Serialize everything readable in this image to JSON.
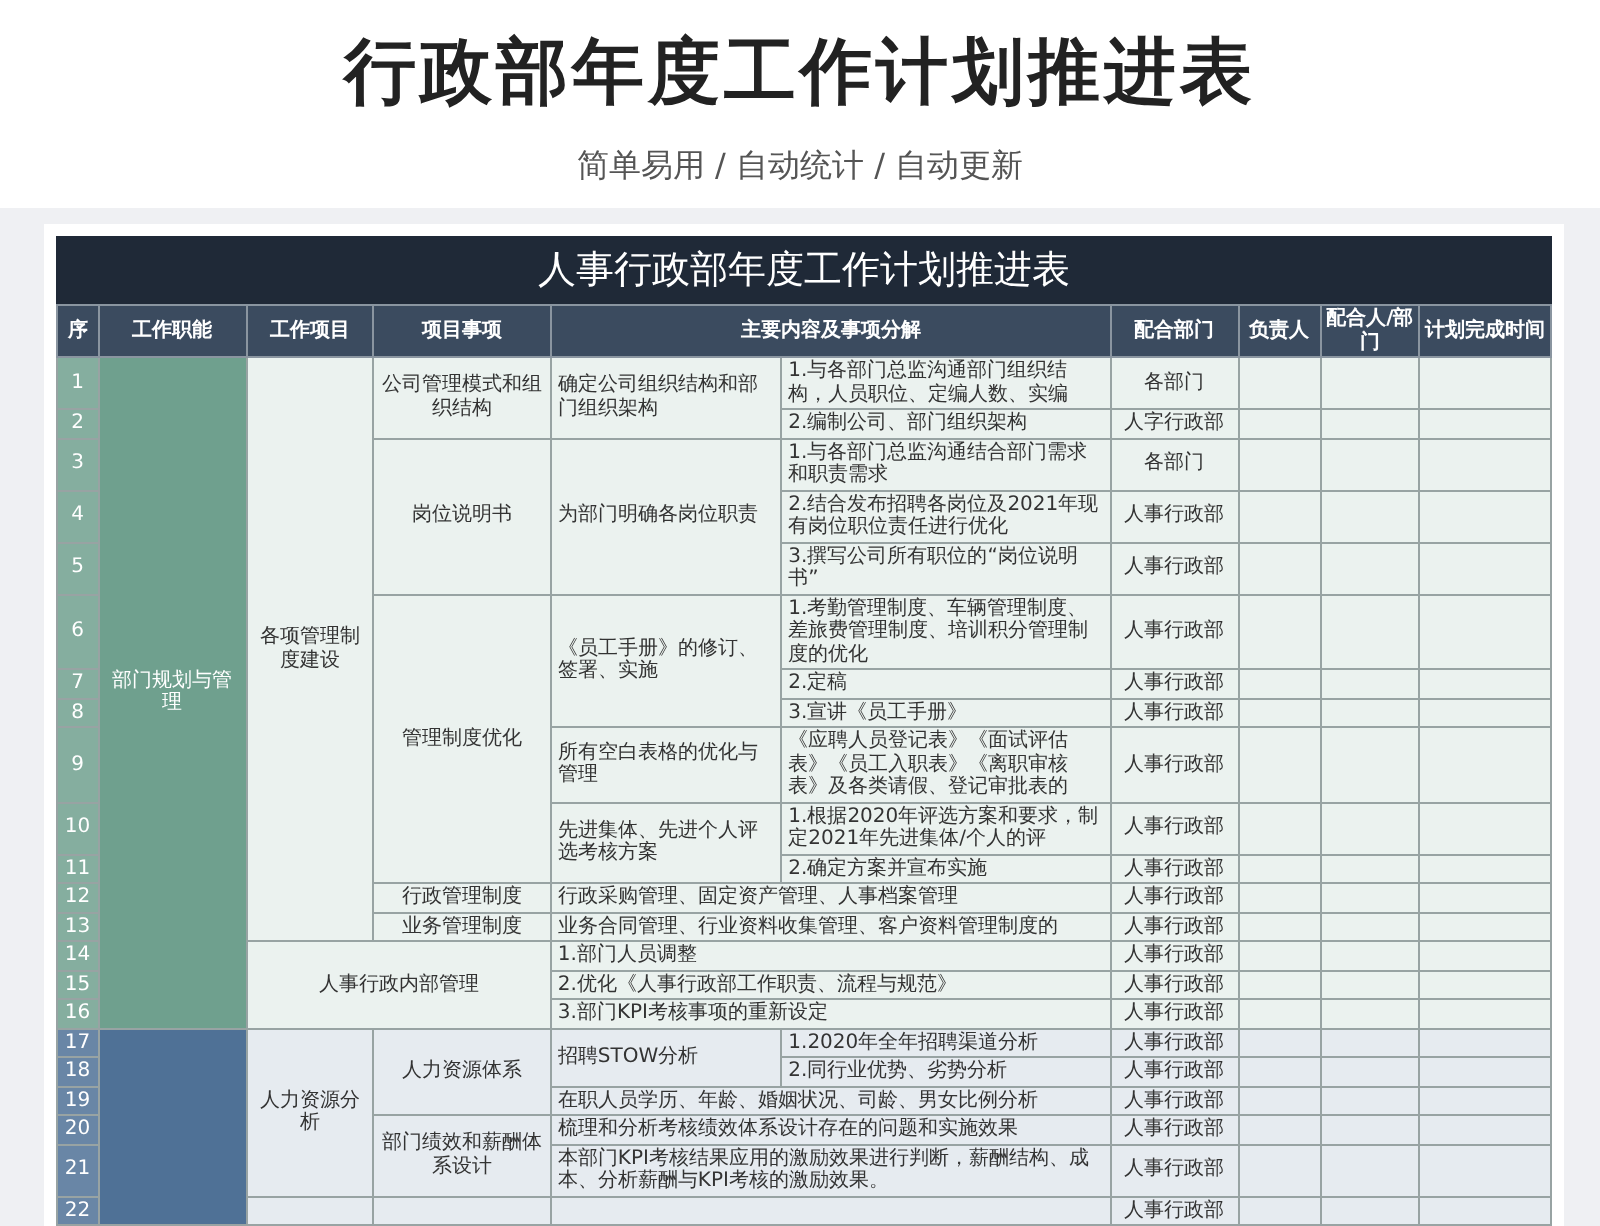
{
  "page": {
    "title": "行政部年度工作计划推进表",
    "subtitle": "简单易用 / 自动统计 / 自动更新"
  },
  "sheet": {
    "title": "人事行政部年度工作计划推进表",
    "columns": [
      "序",
      "工作职能",
      "工作项目",
      "项目事项",
      "主要内容及事项分解",
      "配合部门",
      "负责人",
      "配合人/部门",
      "计划完成时间"
    ],
    "functions": [
      {
        "text": "部门规划与管理",
        "color": "#6fa08e",
        "children": [
          {
            "text": "各项管理制度建设",
            "kind": "normal",
            "children": [
              {
                "text": "公司管理模式和组织结构",
                "children": [
                  {
                    "text": "确定公司组织结构和部门组织架构",
                    "children": [
                      {
                        "text": "1.与各部门总监沟通部门组织结构，人员职位、定编人数、实编",
                        "seq": "1",
                        "dept": "各部门"
                      },
                      {
                        "text": "2.编制公司、部门组织架构",
                        "seq": "2",
                        "dept": "人字行政部"
                      }
                    ]
                  }
                ]
              },
              {
                "text": "岗位说明书",
                "children": [
                  {
                    "text": "为部门明确各岗位职责",
                    "children": [
                      {
                        "text": "1.与各部门总监沟通结合部门需求和职责需求",
                        "seq": "3",
                        "dept": "各部门"
                      },
                      {
                        "text": "2.结合发布招聘各岗位及2021年现有岗位职位责任进行优化",
                        "seq": "4",
                        "dept": "人事行政部"
                      },
                      {
                        "text": "3.撰写公司所有职位的“岗位说明书”",
                        "seq": "5",
                        "dept": "人事行政部"
                      }
                    ]
                  }
                ]
              },
              {
                "text": "管理制度优化",
                "children": [
                  {
                    "text": "《员工手册》的修订、签署、实施",
                    "children": [
                      {
                        "text": "1.考勤管理制度、车辆管理制度、差旅费管理制度、培训积分管理制度的优化",
                        "seq": "6",
                        "dept": "人事行政部"
                      },
                      {
                        "text": "2.定稿",
                        "seq": "7",
                        "dept": "人事行政部"
                      },
                      {
                        "text": "3.宣讲《员工手册》",
                        "seq": "8",
                        "dept": "人事行政部"
                      }
                    ]
                  },
                  {
                    "text": "所有空白表格的优化与管理",
                    "children": [
                      {
                        "text": "《应聘人员登记表》《面试评估表》《员工入职表》《离职审核表》及各类请假、登记审批表的",
                        "seq": "9",
                        "dept": "人事行政部"
                      }
                    ]
                  },
                  {
                    "text": "先进集体、先进个人评选考核方案",
                    "children": [
                      {
                        "text": "1.根据2020年评选方案和要求，制定2021年先进集体/个人的评",
                        "seq": "10",
                        "dept": "人事行政部"
                      },
                      {
                        "text": "2.确定方案并宣布实施",
                        "seq": "11",
                        "dept": "人事行政部"
                      }
                    ]
                  }
                ]
              },
              {
                "text": "行政管理制度",
                "children": [
                  {
                    "text": "行政采购管理、固定资产管理、人事档案管理",
                    "seq": "12",
                    "dept": "人事行政部"
                  }
                ]
              },
              {
                "text": "业务管理制度",
                "children": [
                  {
                    "text": "业务合同管理、行业资料收集管理、客户资料管理制度的",
                    "seq": "13",
                    "dept": "人事行政部"
                  }
                ]
              }
            ]
          },
          {
            "text": "人事行政内部管理",
            "kind": "wide",
            "children": [
              {
                "text": "1.部门人员调整",
                "seq": "14",
                "dept": "人事行政部"
              },
              {
                "text": "2.优化《人事行政部工作职责、流程与规范》",
                "seq": "15",
                "dept": "人事行政部"
              },
              {
                "text": "3.部门KPI考核事项的重新设定",
                "seq": "16",
                "dept": "人事行政部"
              }
            ]
          }
        ]
      },
      {
        "color": "#4f7196",
        "children": [
          {
            "text": "人力资源分析",
            "kind": "normal",
            "children": [
              {
                "text": "人力资源体系",
                "children": [
                  {
                    "text": "招聘STOW分析",
                    "children": [
                      {
                        "text": "1.2020年全年招聘渠道分析",
                        "seq": "17",
                        "dept": "人事行政部"
                      },
                      {
                        "text": "2.同行业优势、劣势分析",
                        "seq": "18",
                        "dept": "人事行政部"
                      }
                    ]
                  },
                  {
                    "text": "在职人员学历、年龄、婚姻状况、司龄、男女比例分析",
                    "seq": "19",
                    "dept": "人事行政部"
                  }
                ]
              },
              {
                "text": "部门绩效和薪酬体系设计",
                "children": [
                  {
                    "text": "梳理和分析考核绩效体系设计存在的问题和实施效果",
                    "seq": "20",
                    "dept": "人事行政部"
                  },
                  {
                    "text": "本部门KPI考核结果应用的激励效果进行判断，薪酬结构、成本、分析薪酬与KPI考核的激励效果。",
                    "seq": "21",
                    "dept": "人事行政部"
                  }
                ]
              }
            ]
          },
          {
            "kind": "normal",
            "children": [
              {
                "children": [
                  {
                    "seq": "22",
                    "dept": "人事行政部"
                  }
                ]
              }
            ]
          }
        ]
      }
    ]
  }
}
